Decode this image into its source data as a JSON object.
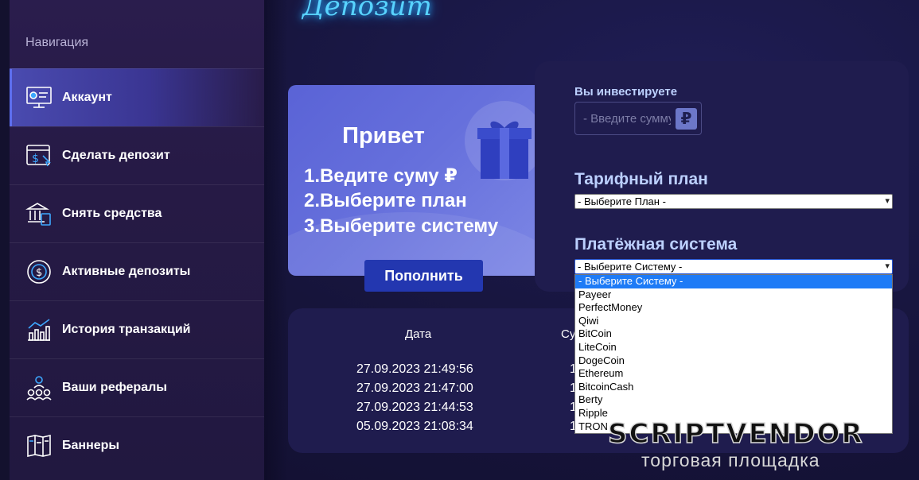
{
  "heading": "Депозит",
  "sidebar": {
    "title": "Навигация",
    "items": [
      {
        "label": "Аккаунт",
        "icon": "dashboard-icon"
      },
      {
        "label": "Сделать депозит",
        "icon": "wallet-dollar-icon"
      },
      {
        "label": "Снять средства",
        "icon": "bank-icon"
      },
      {
        "label": "Активные депозиты",
        "icon": "coin-cycle-icon"
      },
      {
        "label": "История транзакций",
        "icon": "chart-icon"
      },
      {
        "label": "Ваши рефералы",
        "icon": "referrals-icon"
      },
      {
        "label": "Баннеры",
        "icon": "brochure-icon"
      }
    ]
  },
  "promo": {
    "title": "Привет",
    "steps": [
      "1.Ведите суму ₽",
      "2.Выберите план",
      "3.Выберите систему"
    ],
    "button": "Пополнить"
  },
  "form": {
    "invest_label": "Вы инвестируете",
    "amount_placeholder": "- Введите сумму",
    "currency_symbol": "₽",
    "plan_label": "Тарифный план",
    "plan_selected": "- Выберите План -",
    "payment_label": "Платёжная система",
    "payment_selected": "- Выберите Систему -",
    "payment_options": [
      "- Выберите Систему -",
      "Payeer",
      "PerfectMoney",
      "Qiwi",
      "BitCoin",
      "LiteCoin",
      "DogeCoin",
      "Ethereum",
      "BitcoinCash",
      "Berty",
      "Ripple",
      "TRON"
    ]
  },
  "history": {
    "col_date": "Дата",
    "col_sum": "Су",
    "rows": [
      {
        "date": "27.09.2023 21:49:56",
        "sum": "1"
      },
      {
        "date": "27.09.2023 21:47:00",
        "sum": "1"
      },
      {
        "date": "27.09.2023 21:44:53",
        "sum": "1"
      },
      {
        "date": "05.09.2023 21:08:34",
        "sum": "1"
      }
    ]
  },
  "watermark": {
    "title": "SCRIPTVENDOR",
    "subtitle": "торговая площадка"
  },
  "colors": {
    "accent": "#58d3ff",
    "active_nav": "#4a4bb0",
    "button": "#2337b0",
    "label": "#bcd0ff"
  }
}
